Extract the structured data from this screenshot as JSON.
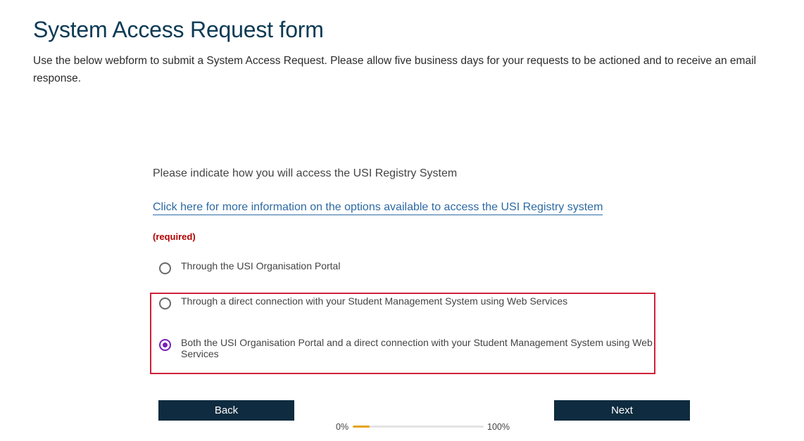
{
  "header": {
    "title": "System Access Request form",
    "intro": "Use the below webform to submit a System Access Request. Please allow five business days for your requests to be actioned and to receive an email response."
  },
  "form": {
    "question": "Please indicate how you will access the USI Registry System",
    "info_link": "Click here for more information on the options available to access the USI Registry system",
    "required_label": "(required)",
    "options": [
      {
        "label": "Through the USI Organisation Portal",
        "selected": false
      },
      {
        "label": "Through a direct connection with your Student Management System using Web Services",
        "selected": false
      },
      {
        "label": "Both the USI Organisation Portal and a direct connection with your Student Management System using Web Services",
        "selected": true
      }
    ],
    "selection_highlight_color": "#d0213a",
    "radio_accent_color": "#7a1fb8"
  },
  "navigation": {
    "back_label": "Back",
    "next_label": "Next"
  },
  "progress": {
    "start_label": "0%",
    "end_label": "100%",
    "value": 0.13,
    "fill_color": "#e8a317"
  }
}
